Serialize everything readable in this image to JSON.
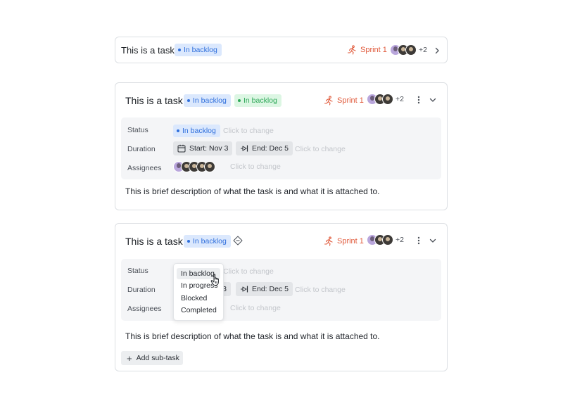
{
  "colors": {
    "accent_blue": "#2f6fdc",
    "badge_blue_bg": "#dbe8fd",
    "accent_green": "#2ea858",
    "badge_green_bg": "#dcf6e3",
    "sprint_orange": "#e0593a",
    "panel_bg": "#f4f5f7"
  },
  "task_compact": {
    "title": "This is a task",
    "status_badge": "In backlog",
    "sprint": "Sprint 1",
    "assignees_more": "+2",
    "expand_icon": "chevron-right-icon"
  },
  "task_expanded": {
    "title": "This is a task",
    "status_badge": "In backlog",
    "status_badge_2": "In backlog",
    "sprint": "Sprint 1",
    "assignees_more": "+2",
    "menu_icon": "more-vertical-icon",
    "collapse_icon": "chevron-down-icon",
    "status_label": "Status",
    "status_value": "In backlog",
    "status_hint": "Click to change",
    "duration_label": "Duration",
    "start_chip": "Start: Nov 3",
    "end_chip": "End: Dec 5",
    "duration_hint": "Click to change",
    "assignees_label": "Assignees",
    "assignees_hint": "Click to change",
    "description": "This is brief description of what the task is and what it is attached to."
  },
  "task_editing": {
    "title": "This is a task",
    "status_badge": "In backlog",
    "sprint": "Sprint 1",
    "assignees_more": "+2",
    "status_label": "Status",
    "status_hint": "Click to change",
    "duration_label": "Duration",
    "start_chip_partial": "3",
    "end_chip": "End: Dec 5",
    "duration_hint": "Click to change",
    "assignees_label": "Assignees",
    "assignees_hint": "Click to change",
    "description": "This is brief description of what the task is and what it is attached to.",
    "add_subtask": "Add sub-task",
    "status_dropdown": {
      "options": [
        "In backlog",
        "In progress",
        "Blocked",
        "Completed"
      ],
      "hovered": "In backlog"
    }
  }
}
